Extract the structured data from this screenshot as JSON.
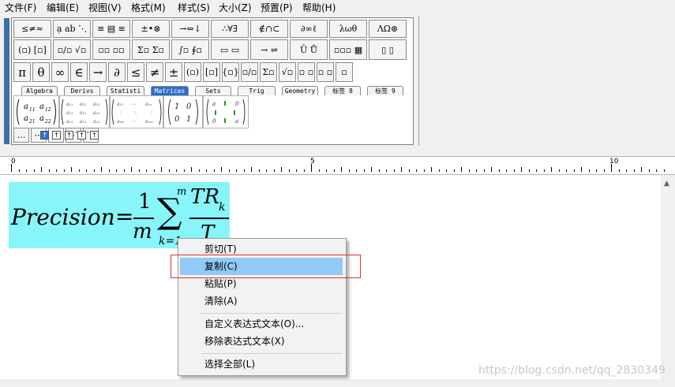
{
  "menu": [
    "文件(F)",
    "编辑(E)",
    "视图(V)",
    "格式(M)",
    "样式(S)",
    "大小(Z)",
    "预置(P)",
    "帮助(H)"
  ],
  "palette": {
    "row1": [
      "≤≠≈",
      "ạ ab ⋱",
      "≡ ▤ ≡",
      "±•⊗",
      "→⇔↓",
      "∴∀∃",
      "∉∩⊂",
      "∂∞ℓ",
      "λωθ",
      "ΛΩ⊛"
    ],
    "row2": [
      "(▫) [▫]",
      "▫/▫ √▫",
      "▫▫ ▫▫",
      "Σ▫ Σ▫",
      "∫▫ ∮▫",
      "▭ ▭",
      "→ ⇌",
      "Ū Ů",
      "▫▫▫ ▦",
      "▯ ▯"
    ],
    "row3": [
      "π",
      "θ",
      "∞",
      "∈",
      "→",
      "∂",
      "≤",
      "≠",
      "±",
      "(▫)",
      "[▫]",
      "{▫}",
      "▫/▫",
      "Σ▫",
      "√▫",
      "▫ ▫",
      "▫ ▫",
      "▫"
    ],
    "tabs": [
      "Algebra",
      "Derivs",
      "Statisti",
      "Matrices",
      "Sets",
      "Trig",
      "Geometry",
      "标签 8",
      "标签 9"
    ],
    "active_tab": "Matrices",
    "templates": [
      "a11 a12 / a21 a22",
      "a11 a12 a13 ...",
      "a11 ⋯ a1n / am1 ⋯ amn",
      "1 0 / 0 1",
      "a1 0 / 0 an"
    ],
    "row5": [
      "...",
      "⋯",
      "⋮",
      "⋰",
      "⋱"
    ]
  },
  "ruler": {
    "labels": [
      "0",
      "5",
      "10"
    ]
  },
  "formula": {
    "lhs": "Precision",
    "eq": "=",
    "frac_num": "1",
    "frac_den": "m",
    "sum": "∑",
    "sum_top": "m",
    "sum_bottom": "k=1",
    "num_main": "TR",
    "num_sub": "k",
    "den": "T"
  },
  "context_menu": {
    "items": [
      {
        "label": "剪切(T)"
      },
      {
        "label": "复制(C)",
        "highlighted": true
      },
      {
        "label": "粘贴(P)"
      },
      {
        "label": "清除(A)"
      },
      {
        "label": "自定义表达式文本(O)..."
      },
      {
        "label": "移除表达式文本(X)"
      },
      {
        "label": "选择全部(L)"
      }
    ]
  },
  "watermark": "https://blog.csdn.net/qq_2830349",
  "colors": {
    "formula_bg": "#87f5fa",
    "highlight": "#91c9f7",
    "red_box": "#e03030",
    "active_tab": "#2d6fc9"
  }
}
